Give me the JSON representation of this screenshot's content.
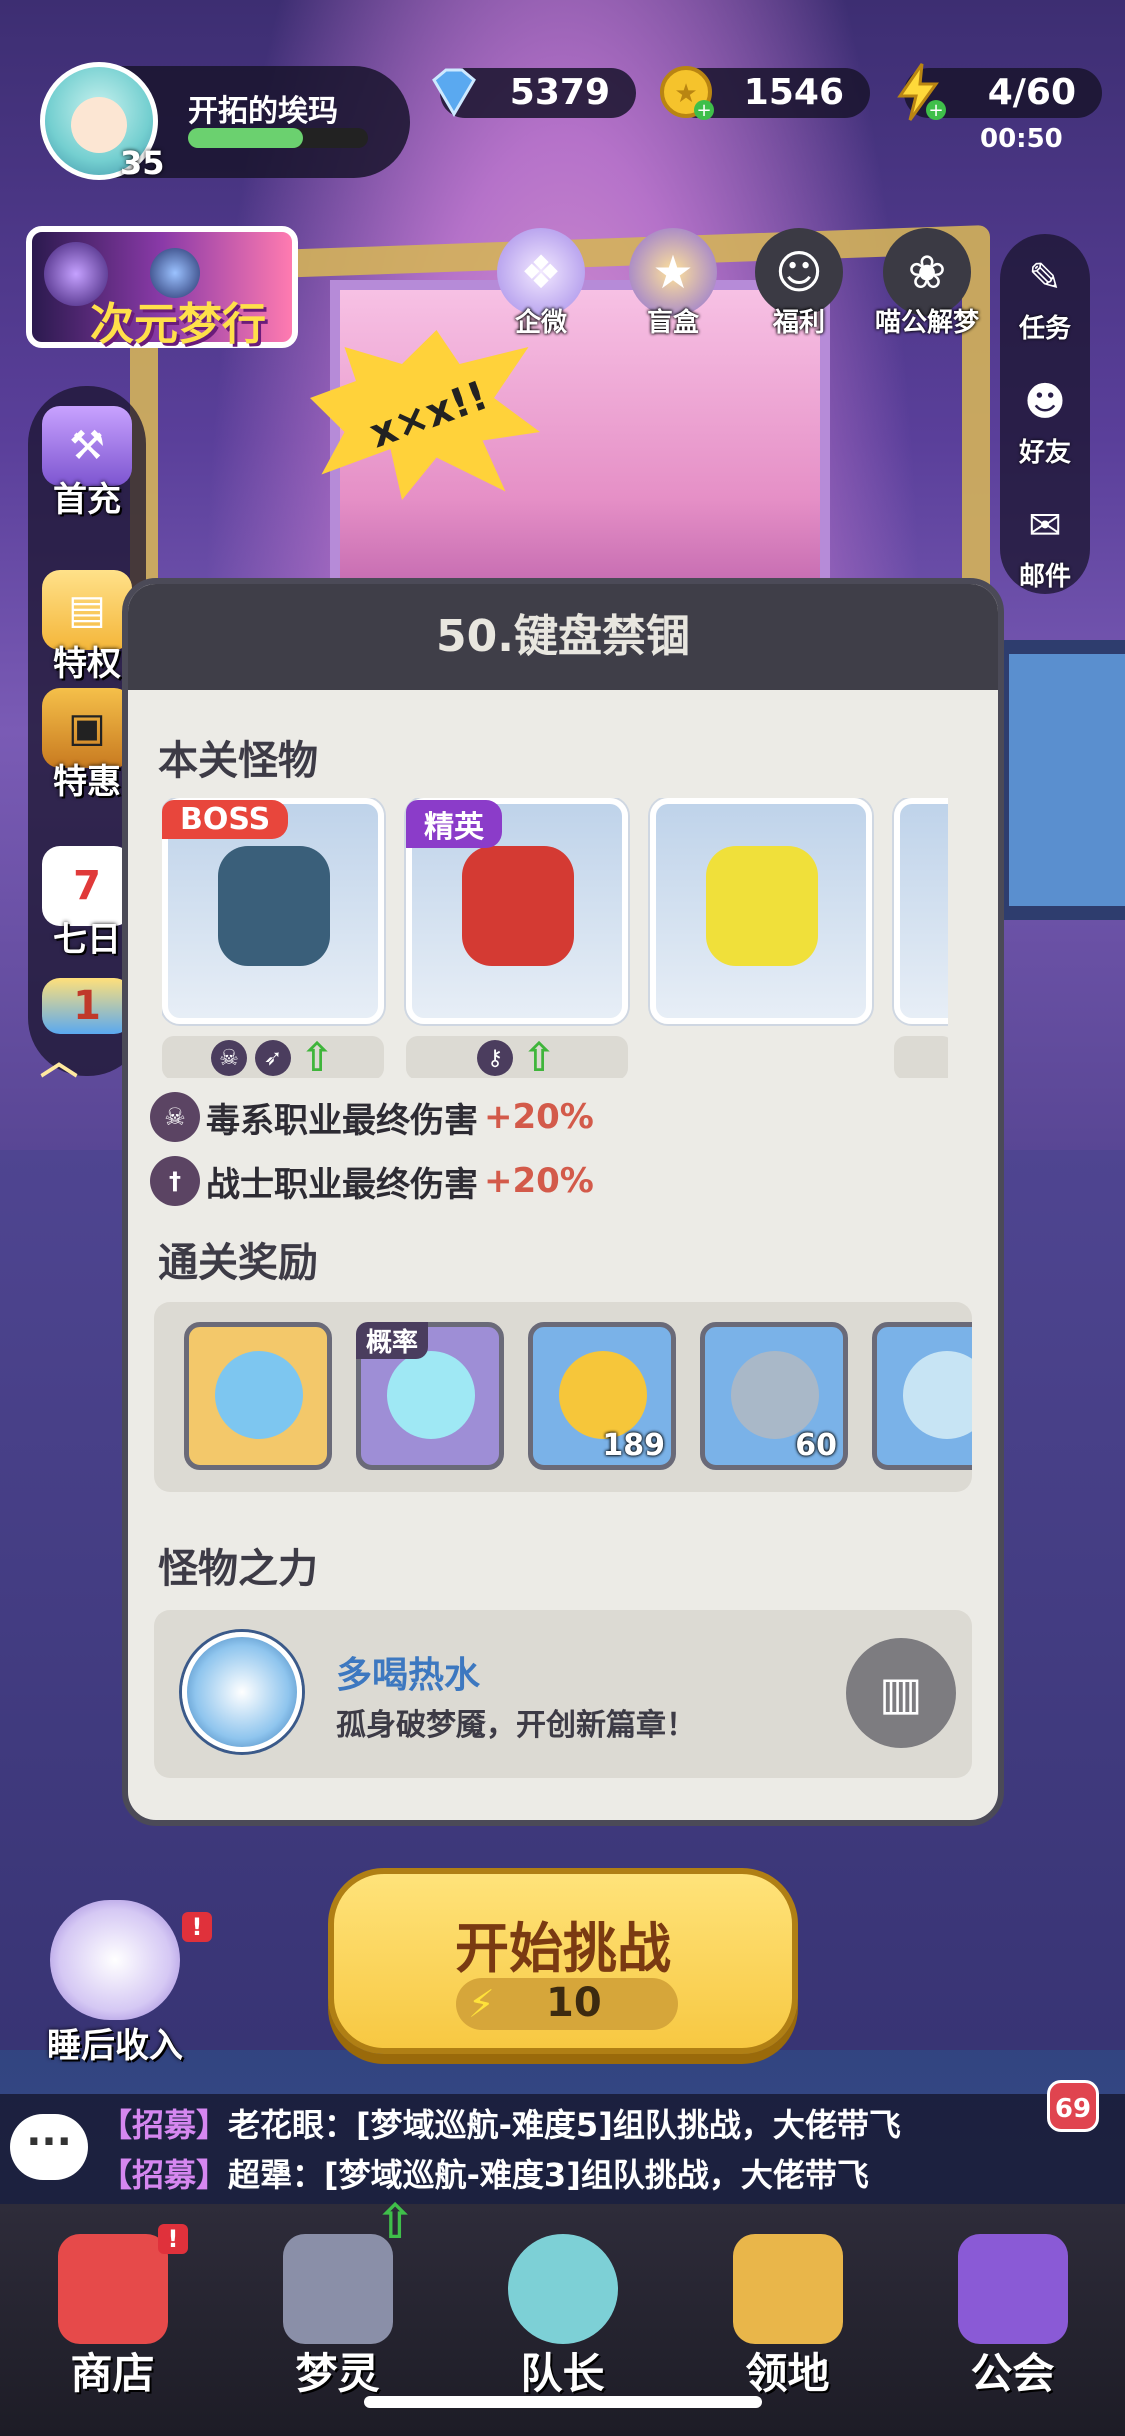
{
  "player": {
    "name": "开拓的埃玛",
    "level": "35",
    "xp_fraction": 0.64
  },
  "currencies": {
    "gems": "5379",
    "gold": "1546",
    "stamina": "4/60",
    "stamina_timer": "00:50"
  },
  "event_banner": {
    "label": "次元梦行"
  },
  "top_icons": [
    {
      "label": "企微",
      "icon": "gift-box-icon"
    },
    {
      "label": "盲盒",
      "icon": "mystery-box-icon"
    },
    {
      "label": "福利",
      "icon": "welfare-icon"
    },
    {
      "label": "喵公解梦",
      "icon": "cat-icon"
    }
  ],
  "left_menu": [
    {
      "label": "首充",
      "icon": "hammer-icon"
    },
    {
      "label": "特权",
      "icon": "card-icon"
    },
    {
      "label": "特惠",
      "icon": "chest-icon"
    },
    {
      "label": "七日",
      "icon": "calendar-icon",
      "badge": "7"
    },
    {
      "label": "",
      "icon": "cube-icon",
      "badge": "1"
    }
  ],
  "right_menu": [
    {
      "label": "任务",
      "icon": "task-icon"
    },
    {
      "label": "好友",
      "icon": "friends-icon"
    },
    {
      "label": "邮件",
      "icon": "mail-icon"
    }
  ],
  "stage": {
    "title": "50.键盘禁锢",
    "monsters_header": "本关怪物",
    "monsters": [
      {
        "tag": "BOSS",
        "tag_color": "#e8463c",
        "color": "#3a5f7a",
        "traits": [
          "poison-trait-icon",
          "bow-trait-icon",
          "up-arrow-icon"
        ]
      },
      {
        "tag": "精英",
        "tag_color": "#8b3cc9",
        "color": "#d43a33",
        "traits": [
          "key-trait-icon",
          "up-arrow-icon"
        ]
      },
      {
        "tag": "",
        "tag_color": "",
        "color": "#f0e03a",
        "traits": []
      },
      {
        "tag": "",
        "tag_color": "",
        "color": "#9bc04a",
        "traits": []
      }
    ],
    "buffs": [
      {
        "text": "毒系职业最终伤害",
        "value": "+20%",
        "icon": "poison-icon"
      },
      {
        "text": "战士职业最终伤害",
        "value": "+20%",
        "icon": "sword-icon"
      }
    ],
    "rewards_header": "通关奖励",
    "rewards": [
      {
        "icon": "blue-chest-icon",
        "qty": "",
        "tag": "",
        "bg": "#f3c86a",
        "fill": "#7dc6f0"
      },
      {
        "icon": "crystal-relic-icon",
        "qty": "",
        "tag": "概率",
        "bg": "#9e8ed6",
        "fill": "#9fe8f4"
      },
      {
        "icon": "gold-coin-icon",
        "qty": "189",
        "tag": "",
        "bg": "#7ab2e8",
        "fill": "#f6c63a"
      },
      {
        "icon": "exp-badge-icon",
        "qty": "60",
        "tag": "",
        "bg": "#7ab2e8",
        "fill": "#a9b8c8"
      },
      {
        "icon": "map-scroll-icon",
        "qty": "",
        "tag": "",
        "bg": "#7ab2e8",
        "fill": "#c7e4f4"
      }
    ],
    "power_header": "怪物之力",
    "power": {
      "name": "多喝热水",
      "desc": "孤身破梦魇，开创新篇章！"
    }
  },
  "start": {
    "label": "开始挑战",
    "cost": "10"
  },
  "sleep": {
    "label": "睡后收入"
  },
  "chat": {
    "lines": [
      {
        "tag": "【招募】",
        "text": "老花眼：[梦域巡航-难度5]组队挑战，大佬带飞"
      },
      {
        "tag": "【招募】",
        "text": "超犟：[梦域巡航-难度3]组队挑战，大佬带飞"
      }
    ],
    "unread": "69"
  },
  "bottom_nav": [
    {
      "label": "商店",
      "icon": "shop-icon",
      "color": "#e64a4a"
    },
    {
      "label": "梦灵",
      "icon": "robot-icon",
      "color": "#8a8fa8"
    },
    {
      "label": "队长",
      "icon": "captain-icon",
      "color": "#7dd0d6"
    },
    {
      "label": "领地",
      "icon": "portal-door-icon",
      "color": "#e9b64a"
    },
    {
      "label": "公会",
      "icon": "guild-trophy-icon",
      "color": "#8a5ad6"
    }
  ]
}
